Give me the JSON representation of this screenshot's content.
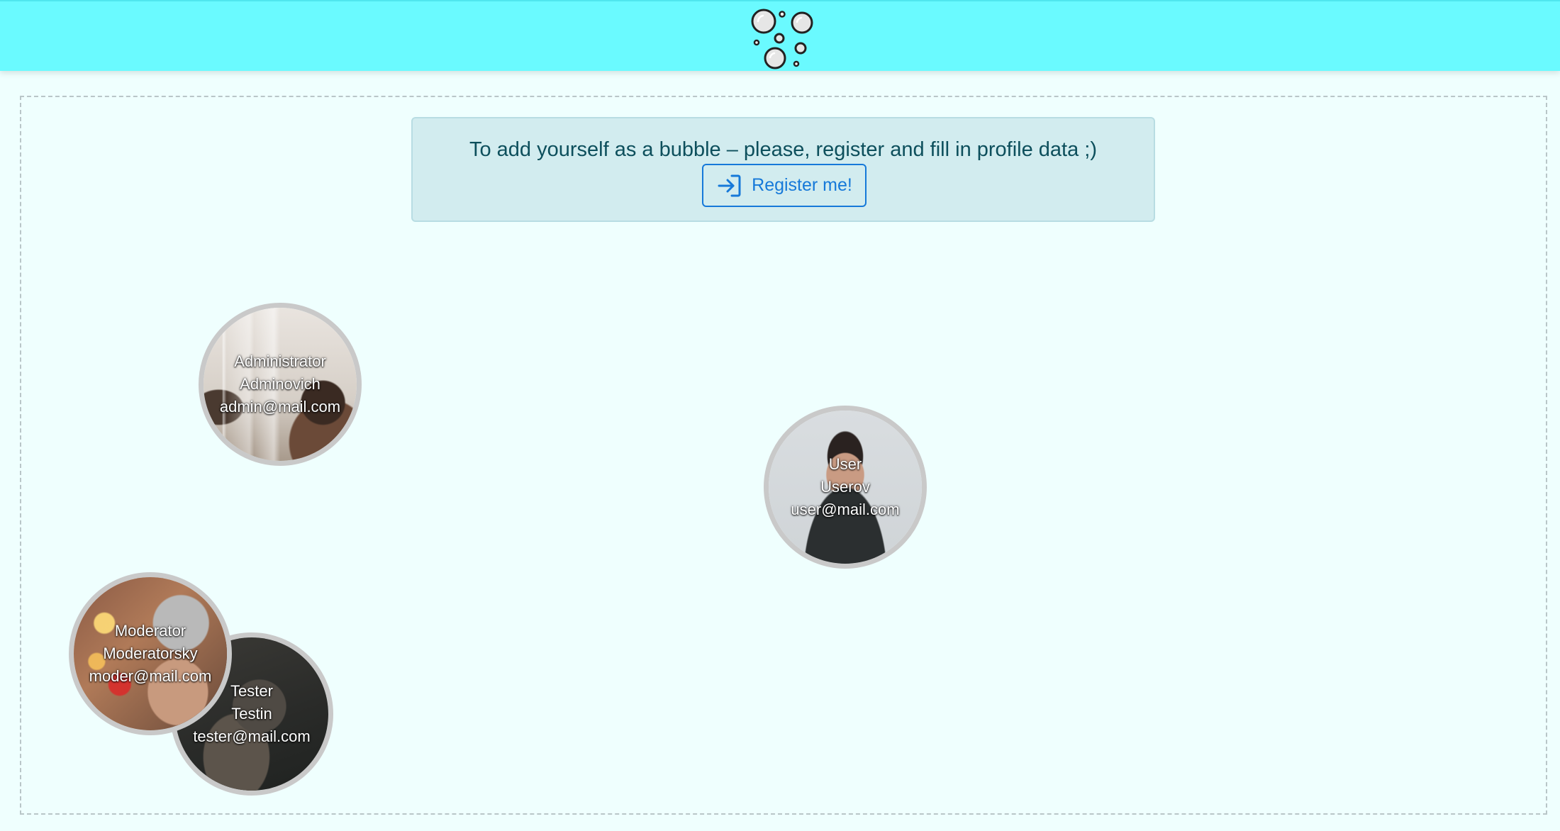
{
  "header": {
    "logo_icon": "bubbles-icon",
    "background_color": "#6afaff"
  },
  "notice": {
    "text": "To add yourself as a bubble – please, register and fill in profile data ;)",
    "register_label": "Register me!",
    "register_icon": "sign-in-icon",
    "accent_color": "#1679d9"
  },
  "bubbles": [
    {
      "first_name": "Administrator",
      "last_name": "Adminovich",
      "email": "admin@mail.com"
    },
    {
      "first_name": "User",
      "last_name": "Userov",
      "email": "user@mail.com"
    },
    {
      "first_name": "Tester",
      "last_name": "Testin",
      "email": "tester@mail.com"
    },
    {
      "first_name": "Moderator",
      "last_name": "Moderatorsky",
      "email": "moder@mail.com"
    }
  ]
}
